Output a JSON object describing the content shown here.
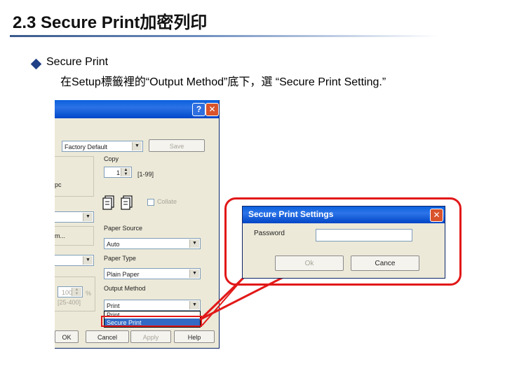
{
  "slide": {
    "title": "2.3 Secure Print加密列印",
    "bullet_label": "Secure Print",
    "bullet_sub": "在Setup標籤裡的“Output Method”底下，選 “Secure Print Setting.”"
  },
  "print_dialog": {
    "help_glyph": "?",
    "close_glyph": "✕",
    "profile_value": "Factory Default",
    "save_label": "Save",
    "copy_label": "Copy",
    "copy_value": "1",
    "copy_range": "[1-99]",
    "left_fragment_1": "pc",
    "left_fragment_2": "m...",
    "collate_label": "Collate",
    "paper_source_label": "Paper Source",
    "paper_source_value": "Auto",
    "paper_type_label": "Paper Type",
    "paper_type_value": "Plain Paper",
    "output_method_label": "Output Method",
    "output_method_value": "Print",
    "dropdown_options": [
      "Print",
      "Secure Print"
    ],
    "dropdown_selected": "Secure Print",
    "spin_value": "100",
    "spin_unit": "%",
    "spin_range": "[25-400]",
    "ok_label": "OK",
    "cancel_label": "Cancel",
    "apply_label": "Apply",
    "help_label": "Help"
  },
  "secure_dialog": {
    "title": "Secure Print Settings",
    "password_label": "Password",
    "password_value": "",
    "ok_label": "Ok",
    "cancel_label": "Cance",
    "close_glyph": "✕"
  },
  "colors": {
    "callout": "#e21818",
    "xp_title_blue": "#0a5fdc",
    "dialog_face": "#ece9d8",
    "selection": "#316ac5",
    "bullet": "#1f3f86"
  },
  "icons": [
    "collate-pages-icon",
    "close-icon",
    "help-icon",
    "combo-arrow-icon",
    "diamond-bullet-icon"
  ]
}
